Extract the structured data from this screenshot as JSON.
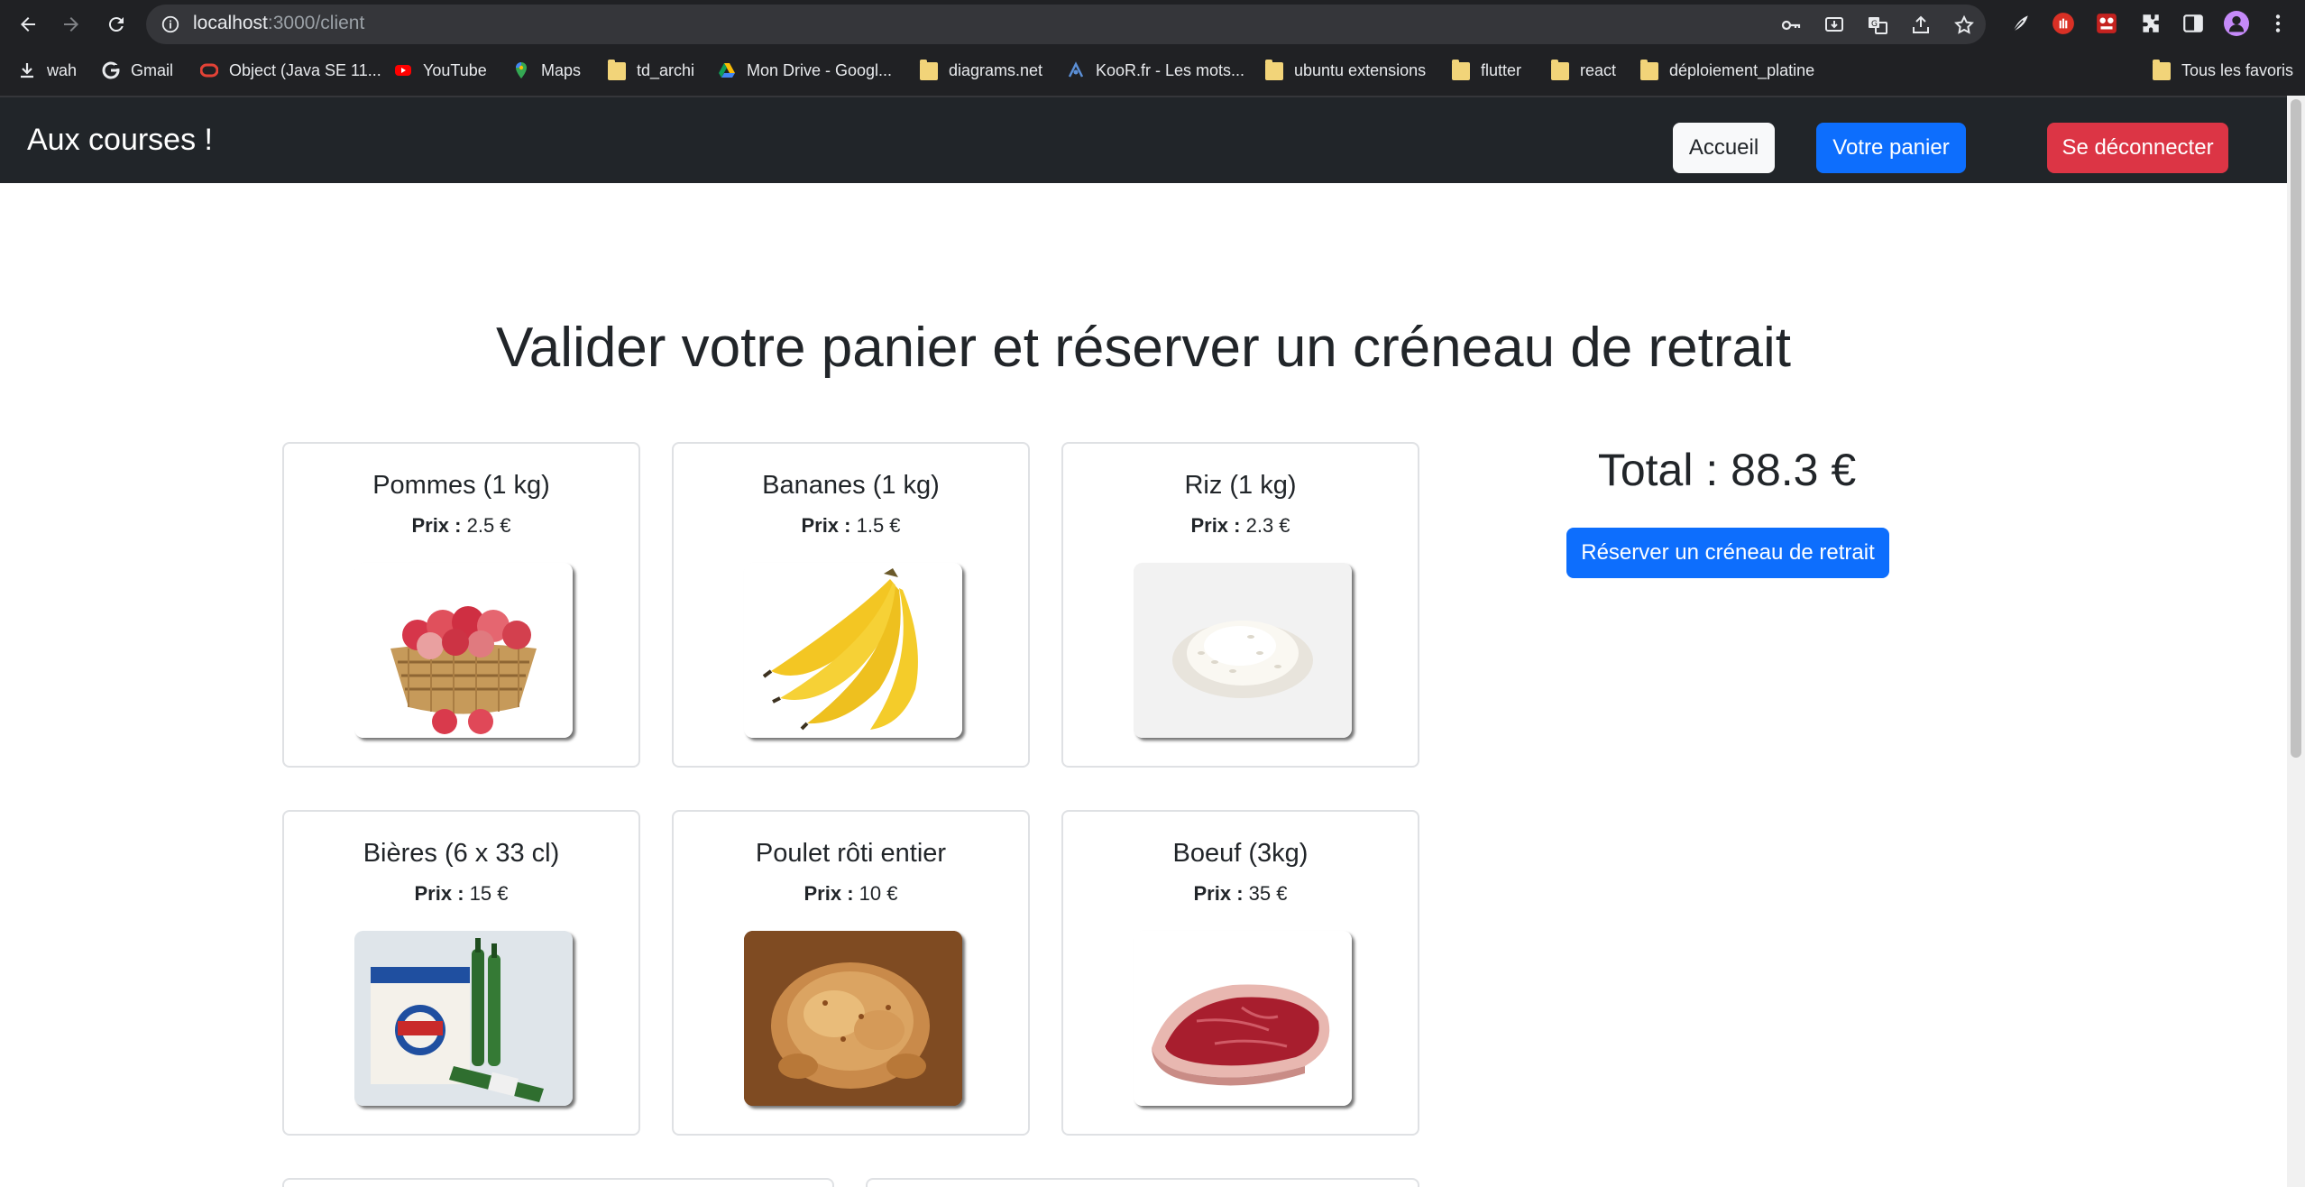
{
  "browser": {
    "url_host": "localhost",
    "url_path": ":3000/client",
    "bookmarks": [
      {
        "label": "wah",
        "icon": "download-icon"
      },
      {
        "label": "Gmail",
        "icon": "google-icon"
      },
      {
        "label": "Object (Java SE 11...",
        "icon": "oracle-icon"
      },
      {
        "label": "YouTube",
        "icon": "youtube-icon"
      },
      {
        "label": "Maps",
        "icon": "maps-pin-icon"
      },
      {
        "label": "td_archi",
        "icon": "folder-icon"
      },
      {
        "label": "Mon Drive - Googl...",
        "icon": "google-drive-icon"
      },
      {
        "label": "diagrams.net",
        "icon": "folder-icon"
      },
      {
        "label": "KooR.fr - Les mots...",
        "icon": "koor-icon"
      },
      {
        "label": "ubuntu extensions",
        "icon": "folder-icon"
      },
      {
        "label": "flutter",
        "icon": "folder-icon"
      },
      {
        "label": "react",
        "icon": "folder-icon"
      },
      {
        "label": "déploiement_platine",
        "icon": "folder-icon"
      }
    ],
    "all_bookmarks_label": "Tous les favoris"
  },
  "navbar": {
    "brand": "Aux courses !",
    "home_label": "Accueil",
    "cart_label": "Votre panier",
    "logout_label": "Se déconnecter"
  },
  "main": {
    "title": "Valider votre panier et réserver un créneau de retrait",
    "price_label": "Prix :",
    "products": [
      {
        "name": "Pommes (1 kg)",
        "price": "2.5 €",
        "image": "apples-basket"
      },
      {
        "name": "Bananes (1 kg)",
        "price": "1.5 €",
        "image": "bananas"
      },
      {
        "name": "Riz (1 kg)",
        "price": "2.3 €",
        "image": "rice"
      },
      {
        "name": "Bières (6 x 33 cl)",
        "price": "15 €",
        "image": "beer-pack"
      },
      {
        "name": "Poulet rôti entier",
        "price": "10 €",
        "image": "roast-chicken"
      },
      {
        "name": "Boeuf (3kg)",
        "price": "35 €",
        "image": "beef-steak"
      }
    ],
    "total": "Total : 88.3 €",
    "reserve_label": "Réserver un créneau de retrait"
  },
  "colors": {
    "navbar_bg": "#212529",
    "primary": "#0d6efd",
    "danger": "#dc3545",
    "light": "#f8f9fa"
  }
}
